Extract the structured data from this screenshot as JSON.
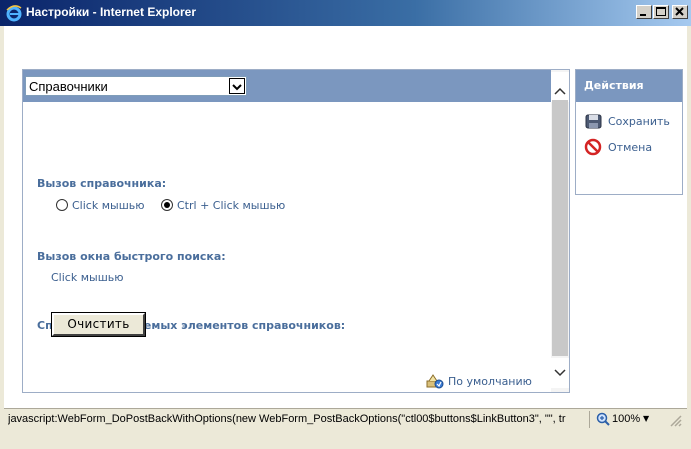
{
  "window": {
    "title": "Настройки - Internet Explorer",
    "icon": "ie-logo-icon"
  },
  "main": {
    "dropdown": {
      "selected": "Справочники"
    },
    "directory_call": {
      "heading": "Вызов справочника:",
      "options": [
        {
          "label": "Click мышью",
          "checked": false
        },
        {
          "label": "Ctrl + Click мышью",
          "checked": true
        }
      ]
    },
    "quick_search": {
      "heading": "Вызов окна быстрого поиска:",
      "value": "Click мышью"
    },
    "used_items": {
      "heading": "Списки используемых элементов справочников:",
      "clear_button": "Очистить"
    },
    "default_link": "По умолчанию"
  },
  "actions": {
    "title": "Действия",
    "items": [
      {
        "label": "Сохранить",
        "icon": "save-icon"
      },
      {
        "label": "Отмена",
        "icon": "cancel-icon"
      }
    ]
  },
  "statusbar": {
    "text": "javascript:WebForm_DoPostBackWithOptions(new WebForm_PostBackOptions(\"ctl00$buttons$LinkButton3\", \"\", tr",
    "zoom": "100%"
  },
  "colors": {
    "header_bg": "#7b97bf",
    "label_blue": "#4a6e9c",
    "link_blue": "#3b5f8f"
  }
}
